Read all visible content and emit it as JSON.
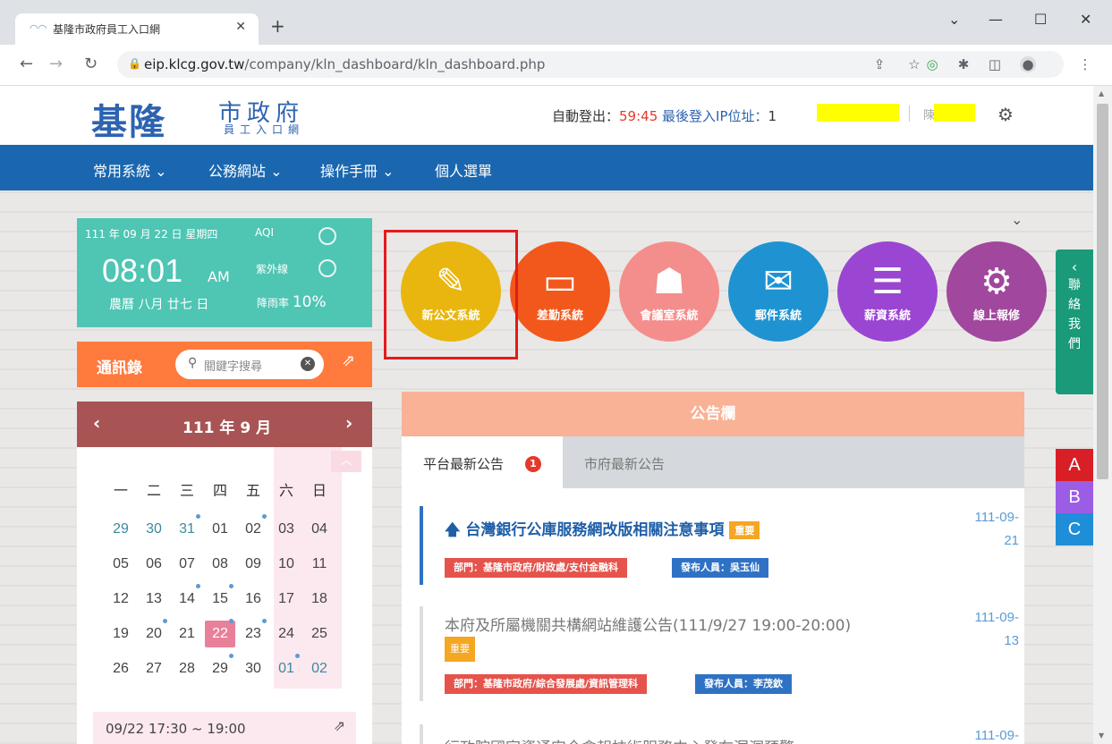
{
  "browser": {
    "tab_title": "基隆市政府員工入口網",
    "url_domain": "eip.klcg.gov.tw",
    "url_path": "/company/kln_dashboard/kln_dashboard.php"
  },
  "header": {
    "logo_main": "基隆",
    "logo_sub1": "市政府",
    "logo_sub2": "員工入口網",
    "logout_label": "自動登出：",
    "logout_countdown": "59:45",
    "last_ip_label": "最後登入IP位址：",
    "ip_visible": "1",
    "user_visible": "陳"
  },
  "nav": {
    "items": [
      {
        "label": "常用系統 ⌄"
      },
      {
        "label": "公務網站 ⌄"
      },
      {
        "label": "操作手冊 ⌄"
      },
      {
        "label": "個人選單"
      }
    ]
  },
  "weather": {
    "date": "111 年 09 月 22 日 星期四",
    "aqi_label": "AQI",
    "time": "08:01",
    "ampm": "AM",
    "uv_label": "紫外線",
    "lunar": "農曆 八月 廿七 日",
    "rain_label": "降雨率",
    "rain_value": "10%"
  },
  "contacts": {
    "title": "通訊錄",
    "search_placeholder": "關鍵字搜尋"
  },
  "calendar": {
    "title": "111 年 9 月",
    "weekdays": [
      "一",
      "二",
      "三",
      "四",
      "五",
      "六",
      "日"
    ],
    "weeks": [
      [
        "29",
        "30",
        "31",
        "01",
        "02",
        "03",
        "04"
      ],
      [
        "05",
        "06",
        "07",
        "08",
        "09",
        "10",
        "11"
      ],
      [
        "12",
        "13",
        "14",
        "15",
        "16",
        "17",
        "18"
      ],
      [
        "19",
        "20",
        "21",
        "22",
        "23",
        "24",
        "25"
      ],
      [
        "26",
        "27",
        "28",
        "29",
        "30",
        "01",
        "02"
      ]
    ],
    "today": "22",
    "event_time": "09/22 17:30 ~ 19:00"
  },
  "systems": [
    {
      "label": "新公文系統",
      "icon": "document-edit-icon",
      "color": "#e9b60f"
    },
    {
      "label": "差勤系統",
      "icon": "briefcase-monitor-icon",
      "color": "#f2581c"
    },
    {
      "label": "會議室系統",
      "icon": "meeting-icon",
      "color": "#f48e8c"
    },
    {
      "label": "郵件系統",
      "icon": "mail-icon",
      "color": "#1f93d2"
    },
    {
      "label": "薪資系統",
      "icon": "payroll-icon",
      "color": "#9b45d3"
    },
    {
      "label": "線上報修",
      "icon": "repair-icon",
      "color": "#a1479d"
    }
  ],
  "contact_us": {
    "label": "聯絡我們"
  },
  "font_size": {
    "a": "A",
    "b": "B",
    "c": "C"
  },
  "announcements": {
    "header": "公告欄",
    "tab_platform": "平台最新公告",
    "tab_platform_badge": "1",
    "tab_city": "市府最新公告",
    "important_tag": "重要",
    "items": [
      {
        "title": "台灣銀行公庫服務網改版相關注意事項",
        "date_line1": "111-09-",
        "date_line2": "21",
        "dept": "部門：基隆市政府/財政處/支付金融科",
        "publisher": "發布人員：吳玉仙"
      },
      {
        "title": "本府及所屬機關共構網站維護公告(111/9/27 19:00-20:00)",
        "date_line1": "111-09-",
        "date_line2": "13",
        "dept": "部門：基隆市政府/綜合發展處/資訊管理科",
        "publisher": "發布人員：李茂欽"
      },
      {
        "title": "行政院國家資通安全會報技術服務中心發布漏洞預警",
        "date_line1": "111-09-",
        "date_line2": ""
      }
    ]
  },
  "colors": {
    "nav_blue": "#1a67b0",
    "weather_teal": "#4fc5b4",
    "contacts_orange": "#ff7a3d",
    "calendar_maroon": "#a85454",
    "highlight_red": "#e31b1b"
  }
}
